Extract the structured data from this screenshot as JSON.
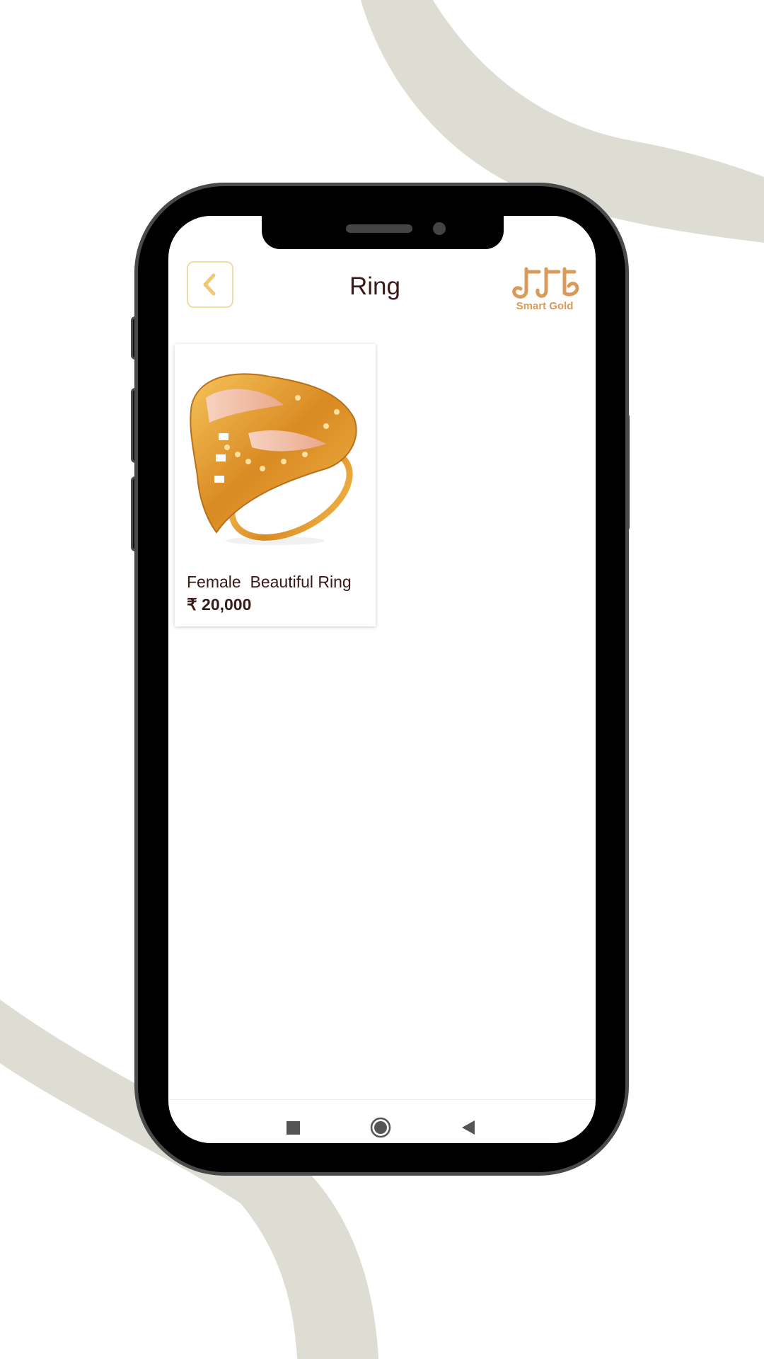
{
  "header": {
    "title": "Ring",
    "back_icon": "chevron-left-icon",
    "logo_text": "Smart Gold"
  },
  "products": [
    {
      "name": "Female  Beautiful Ring",
      "price": "₹ 20,000",
      "image": "gold-ring-image"
    }
  ],
  "navbar": {
    "items": [
      "recent-apps-icon",
      "home-icon",
      "back-icon"
    ]
  },
  "colors": {
    "accent": "#d99b5a",
    "back_border": "#f3d9a6",
    "text": "#3a1a16",
    "swoosh": "#deddd3"
  }
}
